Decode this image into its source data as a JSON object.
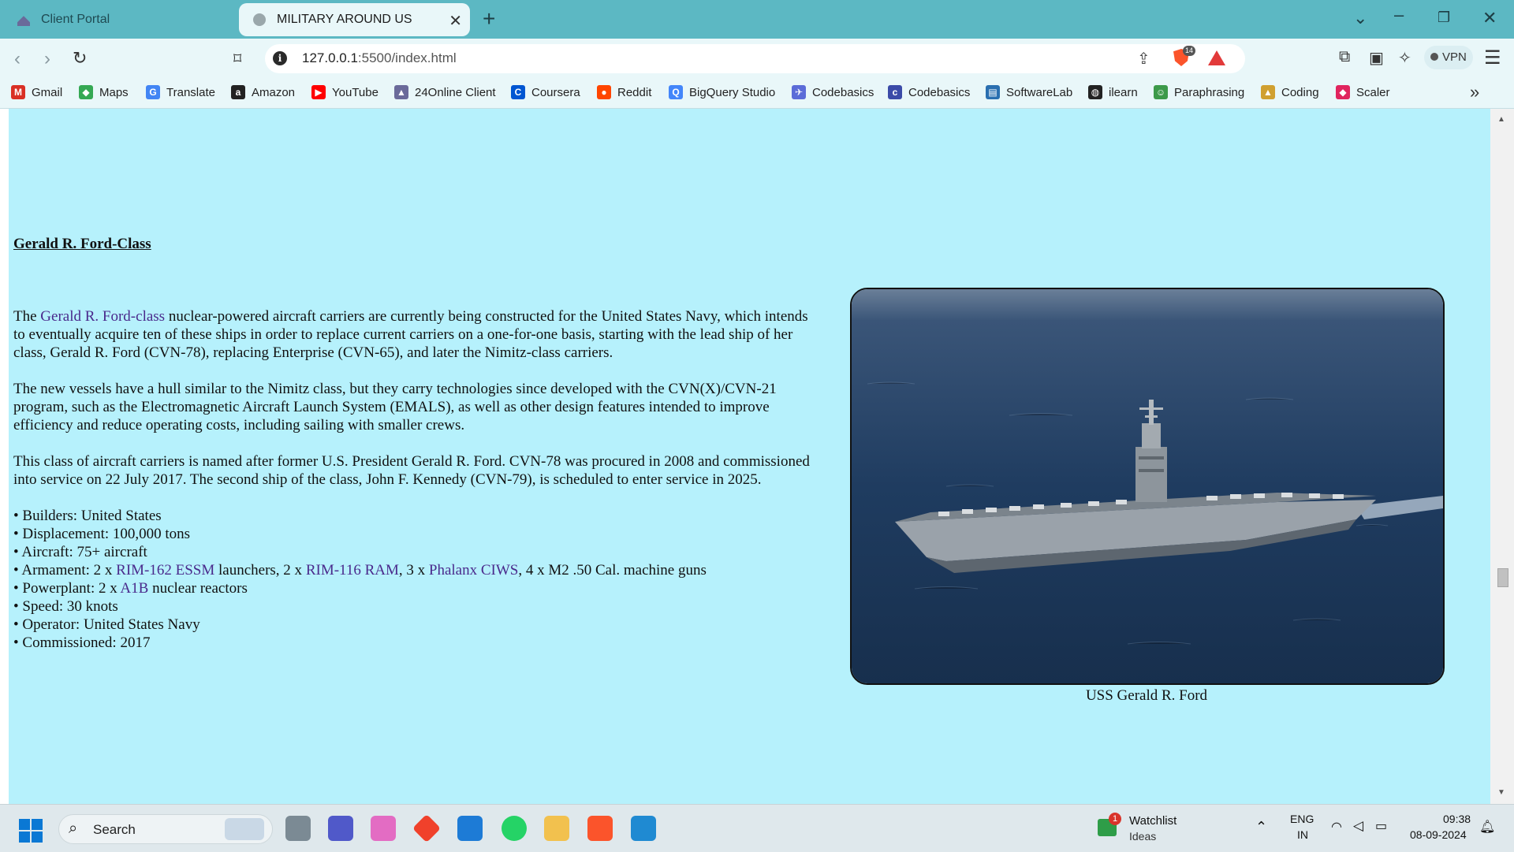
{
  "browser": {
    "tabs": [
      {
        "title": "Client Portal",
        "active": false
      },
      {
        "title": "MILITARY AROUND US",
        "active": true
      }
    ],
    "url_host": "127.0.0.1",
    "url_rest": ":5500/index.html",
    "shield_count": "14",
    "vpn_label": "VPN",
    "bookmarks": [
      {
        "label": "Gmail",
        "icon": "gmail-icon",
        "color": "#d93025",
        "glyph": "M"
      },
      {
        "label": "Maps",
        "icon": "maps-icon",
        "color": "#34a853",
        "glyph": "◆"
      },
      {
        "label": "Translate",
        "icon": "translate-icon",
        "color": "#4285f4",
        "glyph": "G"
      },
      {
        "label": "Amazon",
        "icon": "amazon-icon",
        "color": "#222222",
        "glyph": "a"
      },
      {
        "label": "YouTube",
        "icon": "youtube-icon",
        "color": "#ff0000",
        "glyph": "▶"
      },
      {
        "label": "24Online Client",
        "icon": "24online-icon",
        "color": "#6a6a9a",
        "glyph": "▲"
      },
      {
        "label": "Coursera",
        "icon": "coursera-icon",
        "color": "#0056d2",
        "glyph": "C"
      },
      {
        "label": "Reddit",
        "icon": "reddit-icon",
        "color": "#ff4500",
        "glyph": "●"
      },
      {
        "label": "BigQuery Studio",
        "icon": "bigquery-icon",
        "color": "#4386fa",
        "glyph": "Q"
      },
      {
        "label": "Codebasics",
        "icon": "rocket-icon",
        "color": "#5b6cd8",
        "glyph": "✈"
      },
      {
        "label": "Codebasics",
        "icon": "codebasics-icon",
        "color": "#3b4ba8",
        "glyph": "c"
      },
      {
        "label": "SoftwareLab",
        "icon": "softwarelab-icon",
        "color": "#2a6fb0",
        "glyph": "▤"
      },
      {
        "label": "ilearn",
        "icon": "globe-icon",
        "color": "#222222",
        "glyph": "◍"
      },
      {
        "label": "Paraphrasing",
        "icon": "paraphrasing-icon",
        "color": "#3c9a4a",
        "glyph": "☺"
      },
      {
        "label": "Coding",
        "icon": "coding-icon",
        "color": "#d0a030",
        "glyph": "▲"
      },
      {
        "label": "Scaler",
        "icon": "scaler-icon",
        "color": "#e0245e",
        "glyph": "◆"
      }
    ]
  },
  "page": {
    "heading": "Gerald R. Ford-Class",
    "p1_prefix": "The ",
    "p1_link": "Gerald R. Ford-class",
    "p1_rest": " nuclear-powered aircraft carriers are currently being constructed for the United States Navy, which intends to eventually acquire ten of these ships in order to replace current carriers on a one-for-one basis, starting with the lead ship of her class, Gerald R. Ford (CVN-78), replacing Enterprise (CVN-65), and later the Nimitz-class carriers.",
    "p2": "The new vessels have a hull similar to the Nimitz class, but they carry technologies since developed with the CVN(X)/CVN-21 program, such as the Electromagnetic Aircraft Launch System (EMALS), as well as other design features intended to improve efficiency and reduce operating costs, including sailing with smaller crews.",
    "p3": "This class of aircraft carriers is named after former U.S. President Gerald R. Ford. CVN-78 was procured in 2008 and commissioned into service on 22 July 2017. The second ship of the class, John F. Kennedy (CVN-79), is scheduled to enter service in 2025.",
    "specs": {
      "builders": "• Builders: United States",
      "displacement": "• Displacement: 100,000 tons",
      "aircraft": "• Aircraft: 75+ aircraft",
      "armament_prefix": "• Armament: 2 x ",
      "armament_link1": "RIM-162 ESSM",
      "armament_mid1": " launchers, 2 x ",
      "armament_link2": "RIM-116 RAM",
      "armament_mid2": ", 3 x ",
      "armament_link3": "Phalanx CIWS",
      "armament_suffix": ", 4 x M2 .50 Cal. machine guns",
      "powerplant_prefix": "• Powerplant: 2 x ",
      "powerplant_link": "A1B",
      "powerplant_suffix": " nuclear reactors",
      "speed": "• Speed: 30 knots",
      "operator": "• Operator: United States Navy",
      "commissioned": "• Commissioned: 2017"
    },
    "image_caption": "USS Gerald R. Ford"
  },
  "taskbar": {
    "search_label": "Search",
    "watchlist_title": "Watchlist",
    "watchlist_sub": "Ideas",
    "watchlist_badge": "1",
    "lang_top": "ENG",
    "lang_bottom": "IN",
    "time": "09:38",
    "date": "08-09-2024"
  }
}
